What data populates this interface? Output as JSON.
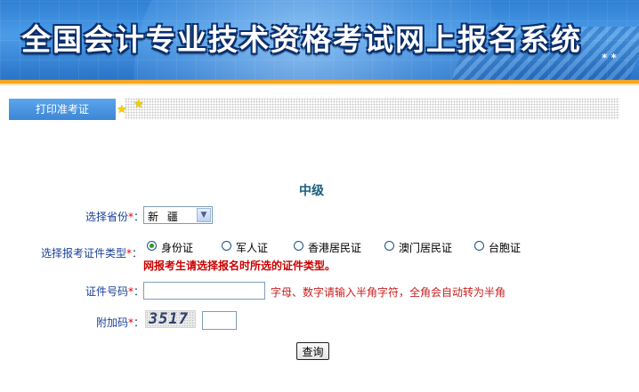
{
  "banner": {
    "title": "全国会计专业技术资格考试网上报名系统",
    "logo_text": "* *"
  },
  "tabs": [
    {
      "label": "打印准考证"
    }
  ],
  "form": {
    "level": "中级",
    "province": {
      "label": "选择省份",
      "required_mark": "*",
      "colon": "：",
      "selected": "新 疆"
    },
    "id_type": {
      "label": "选择报考证件类型",
      "required_mark": "*",
      "colon": "：",
      "options": [
        {
          "label": "身份证",
          "checked": true
        },
        {
          "label": "军人证",
          "checked": false
        },
        {
          "label": "香港居民证",
          "checked": false
        },
        {
          "label": "澳门居民证",
          "checked": false
        },
        {
          "label": "台胞证",
          "checked": false
        }
      ],
      "warning": "网报考生请选择报名时所选的证件类型。"
    },
    "id_number": {
      "label": "证件号码",
      "required_mark": "*",
      "colon": "：",
      "value": "",
      "hint": "字母、数字请输入半角字符，全角会自动转为半角"
    },
    "captcha": {
      "label": "附加码",
      "required_mark": "*",
      "colon": "：",
      "code": "3517",
      "value": ""
    },
    "submit_label": "查询"
  },
  "colors": {
    "banner_blue": "#2f7fd3",
    "stripe_orange": "#f5a623",
    "tab_blue": "#3d86d6",
    "label_blue": "#1b3f9a",
    "level_teal": "#1a5e7d",
    "required_red": "#e00000",
    "warning_red": "#cc0000",
    "radio_green": "#21a121"
  },
  "icons": {
    "tab_decor": "star-icon",
    "select_arrow": "chevron-down-icon"
  }
}
